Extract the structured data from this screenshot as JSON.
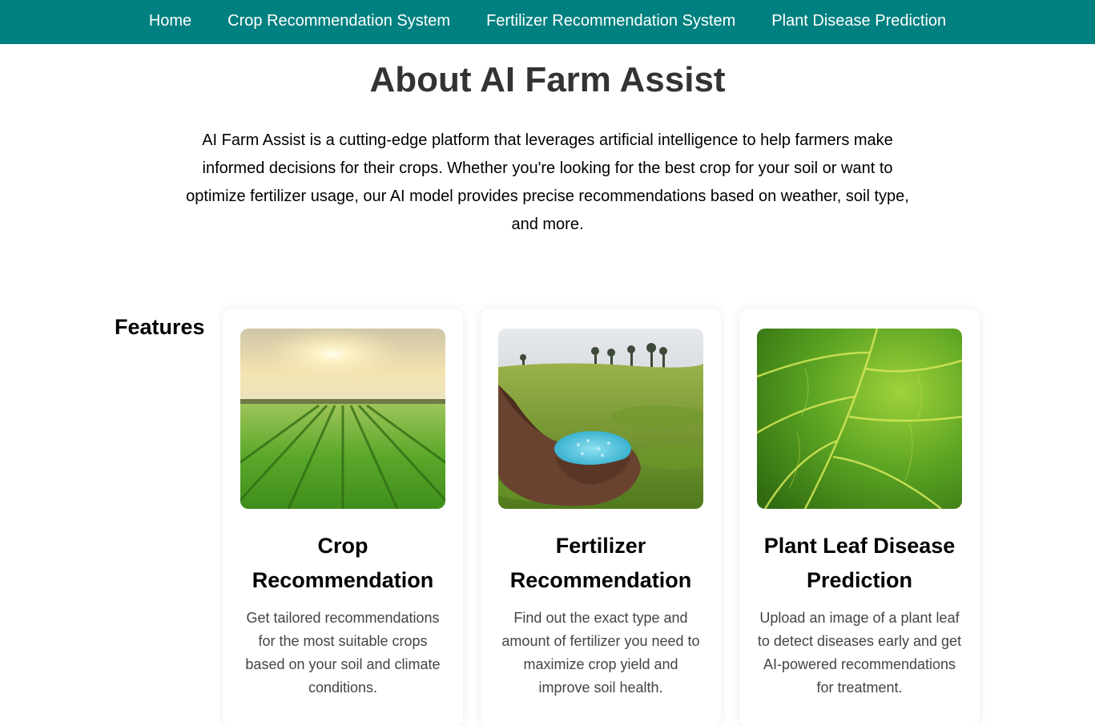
{
  "nav": {
    "items": [
      {
        "label": "Home"
      },
      {
        "label": "Crop Recommendation System"
      },
      {
        "label": "Fertilizer Recommendation System"
      },
      {
        "label": "Plant Disease Prediction"
      }
    ]
  },
  "about": {
    "title": "About AI Farm Assist",
    "text": "AI Farm Assist is a cutting-edge platform that leverages artificial intelligence to help farmers make informed decisions for their crops. Whether you're looking for the best crop for your soil or want to optimize fertilizer usage, our AI model provides precise recommendations based on weather, soil type, and more."
  },
  "features": {
    "title": "Features",
    "cards": [
      {
        "title": "Crop Recommendation",
        "description": "Get tailored recommendations for the most suitable crops based on your soil and climate conditions.",
        "image": "sunrise-crop-field-image"
      },
      {
        "title": "Fertilizer Recommendation",
        "description": "Find out the exact type and amount of fertilizer you need to maximize crop yield and improve soil health.",
        "image": "hands-holding-fertilizer-image"
      },
      {
        "title": "Plant Leaf Disease Prediction",
        "description": "Upload an image of a plant leaf to detect diseases early and get AI-powered recommendations for treatment.",
        "image": "green-leaf-closeup-image"
      }
    ]
  },
  "colors": {
    "navbar": "#008080",
    "title": "#333333",
    "description": "#444444"
  }
}
